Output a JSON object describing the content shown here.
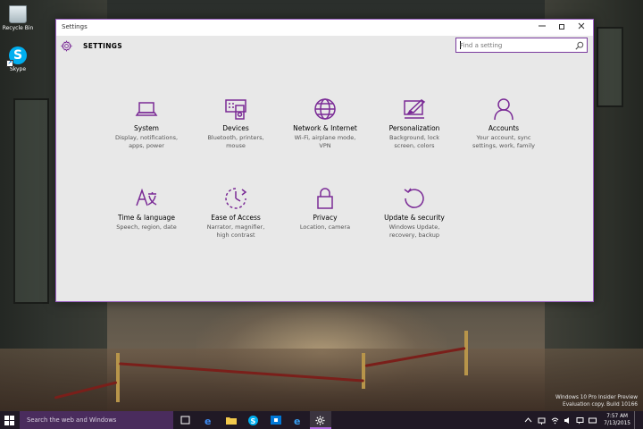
{
  "desktop": {
    "icons": [
      {
        "label": "Recycle Bin",
        "icon": "recycle-bin-icon"
      },
      {
        "label": "Skype",
        "icon": "skype-icon"
      }
    ],
    "watermark_lines": [
      "Windows 10 Pro Insider Preview",
      "Evaluation copy. Build 10166"
    ]
  },
  "window": {
    "title": "Settings",
    "controls": [
      "minimize",
      "maximize",
      "close"
    ]
  },
  "header": {
    "title": "SETTINGS",
    "icon": "gear-icon"
  },
  "search": {
    "placeholder": "Find a setting",
    "value": ""
  },
  "categories": [
    {
      "name": "System",
      "desc_lines": [
        "Display, notifications,",
        "apps, power"
      ],
      "icon": "laptop-icon"
    },
    {
      "name": "Devices",
      "desc_lines": [
        "Bluetooth, printers,",
        "mouse"
      ],
      "icon": "devices-icon"
    },
    {
      "name": "Network & Internet",
      "desc_lines": [
        "Wi-Fi, airplane mode,",
        "VPN"
      ],
      "icon": "globe-icon"
    },
    {
      "name": "Personalization",
      "desc_lines": [
        "Background, lock",
        "screen, colors"
      ],
      "icon": "paintbrush-icon"
    },
    {
      "name": "Accounts",
      "desc_lines": [
        "Your account, sync",
        "settings, work, family"
      ],
      "icon": "person-icon"
    },
    {
      "name": "Time & language",
      "desc_lines": [
        "Speech, region, date"
      ],
      "icon": "time-language-icon"
    },
    {
      "name": "Ease of Access",
      "desc_lines": [
        "Narrator, magnifier,",
        "high contrast"
      ],
      "icon": "ease-of-access-icon"
    },
    {
      "name": "Privacy",
      "desc_lines": [
        "Location, camera"
      ],
      "icon": "lock-icon"
    },
    {
      "name": "Update & security",
      "desc_lines": [
        "Windows Update,",
        "recovery, backup"
      ],
      "icon": "update-icon"
    }
  ],
  "taskbar": {
    "search_text": "Search the web and Windows",
    "apps": [
      "task-view-icon",
      "edge-icon",
      "file-explorer-icon",
      "skype-icon",
      "store-icon",
      "ie-icon",
      "settings-icon"
    ],
    "tray": [
      "up-arrow-icon",
      "network-icon",
      "volume-icon",
      "message-icon",
      "keyboard-icon"
    ],
    "time": "7:57 AM",
    "date": "7/13/2015"
  },
  "colors": {
    "accent": "#7a2a96",
    "taskbar": "#1c1624",
    "window_bg": "#e8e8e8"
  }
}
